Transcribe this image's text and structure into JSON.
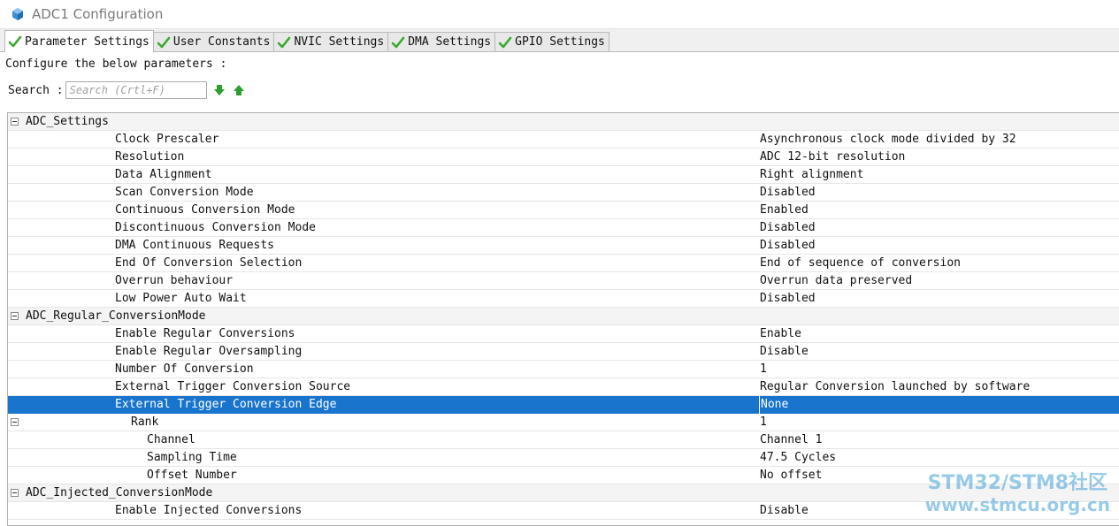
{
  "window": {
    "title": "ADC1 Configuration"
  },
  "colors": {
    "accent": "#1874cd",
    "check": "#3aa82f",
    "arrow": "#2f9e2f"
  },
  "tabs": [
    {
      "label": "Parameter Settings",
      "active": true
    },
    {
      "label": "User Constants",
      "active": false
    },
    {
      "label": "NVIC Settings",
      "active": false
    },
    {
      "label": "DMA Settings",
      "active": false
    },
    {
      "label": "GPIO Settings",
      "active": false
    }
  ],
  "header": {
    "instruction": "Configure the below parameters :"
  },
  "search": {
    "label": "Search :",
    "placeholder": "Search (Crtl+F)"
  },
  "rows": [
    {
      "type": "group",
      "name": "ADC_Settings",
      "value": ""
    },
    {
      "type": "param",
      "indent": 1,
      "name": "Clock Prescaler",
      "value": "Asynchronous clock mode divided by 32"
    },
    {
      "type": "param",
      "indent": 1,
      "name": "Resolution",
      "value": "ADC 12-bit resolution"
    },
    {
      "type": "param",
      "indent": 1,
      "name": "Data Alignment",
      "value": "Right alignment"
    },
    {
      "type": "param",
      "indent": 1,
      "name": "Scan Conversion Mode",
      "value": "Disabled"
    },
    {
      "type": "param",
      "indent": 1,
      "name": "Continuous Conversion Mode",
      "value": "Enabled"
    },
    {
      "type": "param",
      "indent": 1,
      "name": "Discontinuous Conversion Mode",
      "value": "Disabled"
    },
    {
      "type": "param",
      "indent": 1,
      "name": "DMA Continuous Requests",
      "value": "Disabled"
    },
    {
      "type": "param",
      "indent": 1,
      "name": "End Of Conversion Selection",
      "value": "End of sequence of conversion"
    },
    {
      "type": "param",
      "indent": 1,
      "name": "Overrun behaviour",
      "value": "Overrun data preserved"
    },
    {
      "type": "param",
      "indent": 1,
      "name": "Low Power Auto Wait",
      "value": "Disabled"
    },
    {
      "type": "group",
      "name": "ADC_Regular_ConversionMode",
      "value": ""
    },
    {
      "type": "param",
      "indent": 1,
      "name": "Enable Regular Conversions",
      "value": "Enable"
    },
    {
      "type": "param",
      "indent": 1,
      "name": "Enable Regular Oversampling",
      "value": "Disable"
    },
    {
      "type": "param",
      "indent": 1,
      "name": "Number Of Conversion",
      "value": "1"
    },
    {
      "type": "param",
      "indent": 1,
      "name": "External Trigger Conversion Source",
      "value": "Regular Conversion launched by software"
    },
    {
      "type": "param",
      "indent": 1,
      "name": "External Trigger Conversion Edge",
      "value": "None",
      "selected": true
    },
    {
      "type": "subgroup",
      "indent": 2,
      "name": "Rank",
      "value": "1"
    },
    {
      "type": "param",
      "indent": 3,
      "name": "Channel",
      "value": "Channel 1"
    },
    {
      "type": "param",
      "indent": 3,
      "name": "Sampling Time",
      "value": "47.5 Cycles"
    },
    {
      "type": "param",
      "indent": 3,
      "name": "Offset Number",
      "value": "No offset"
    },
    {
      "type": "group",
      "name": "ADC_Injected_ConversionMode",
      "value": ""
    },
    {
      "type": "param",
      "indent": 1,
      "name": "Enable Injected Conversions",
      "value": "Disable"
    }
  ],
  "watermark": {
    "line1": "STM32/STM8社区",
    "line2": "www.stmcu.org.cn"
  }
}
